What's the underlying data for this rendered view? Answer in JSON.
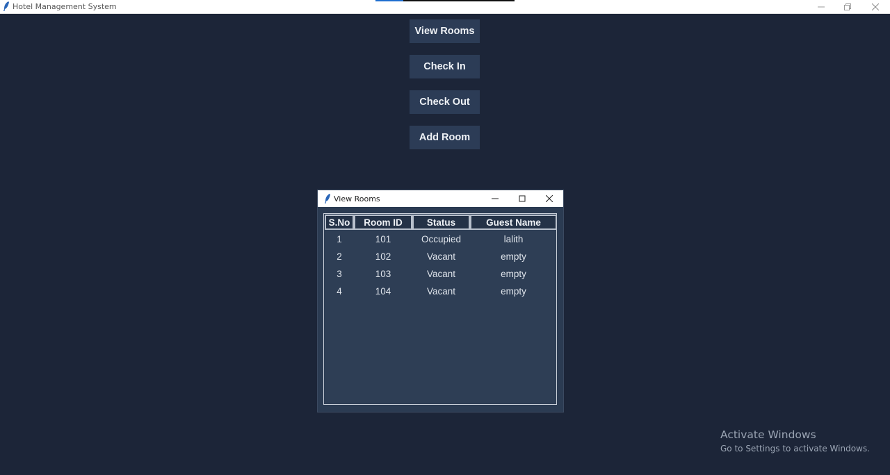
{
  "window": {
    "title": "Hotel Management System",
    "icon": "feather-icon",
    "controls": [
      "minimize-icon",
      "restore-icon",
      "close-icon"
    ]
  },
  "menu": {
    "view_rooms": "View Rooms",
    "check_in": "Check In",
    "check_out": "Check Out",
    "add_room": "Add Room"
  },
  "dialog": {
    "title": "View Rooms",
    "icon": "feather-icon",
    "columns": [
      "S.No",
      "Room ID",
      "Status",
      "Guest Name"
    ],
    "rows": [
      [
        "1",
        "101",
        "Occupied",
        "lalith"
      ],
      [
        "2",
        "102",
        "Vacant",
        "empty"
      ],
      [
        "3",
        "103",
        "Vacant",
        "empty"
      ],
      [
        "4",
        "104",
        "Vacant",
        "empty"
      ]
    ]
  },
  "watermark": {
    "line1": "Activate Windows",
    "line2": "Go to Settings to activate Windows."
  },
  "colors": {
    "background": "#1c2538",
    "button": "#2c3c56",
    "table_bg": "#2e3e55",
    "accent": "#1f6fd0"
  }
}
